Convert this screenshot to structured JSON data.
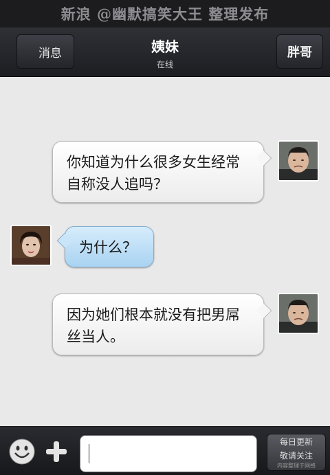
{
  "watermark_top": "新浪 @幽默搞笑大王  整理发布",
  "navbar": {
    "back_label": "消息",
    "title": "姨妹",
    "status": "在线",
    "right_label": "胖哥"
  },
  "messages": [
    {
      "side": "right",
      "text": "你知道为什么很多女生经常自称没人追吗？"
    },
    {
      "side": "left",
      "text": "为什么？"
    },
    {
      "side": "right",
      "text": "因为她们根本就没有把男屌丝当人。"
    }
  ],
  "toolbar": {
    "input_value": "",
    "watermark_line1": "每日更新",
    "watermark_line2": "敬请关注",
    "watermark_line3": "内容整理于网络"
  },
  "colors": {
    "navbar": "#24252a",
    "chat_bg": "#e9e9e9",
    "bubble_white": "#f6f6f6",
    "bubble_blue": "#bfe0f7"
  },
  "icons": [
    "emoji-icon",
    "plus-icon"
  ]
}
